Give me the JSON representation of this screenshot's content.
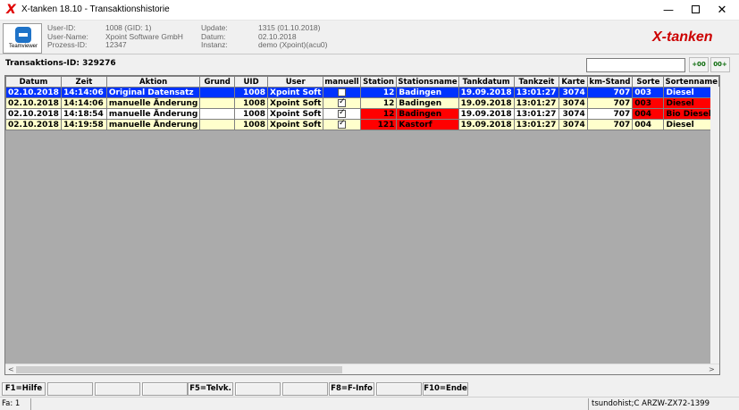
{
  "window": {
    "app_logo": "X",
    "title": "X-tanken 18.10  -  Transaktionshistorie",
    "min": "—",
    "max": "",
    "close": "✕"
  },
  "header": {
    "teamviewer": "Teamviewer",
    "labels": {
      "user_id": "User-ID:",
      "user_name": "User-Name:",
      "process_id": "Prozess-ID:",
      "update": "Update:",
      "datum": "Datum:",
      "instanz": "Instanz:"
    },
    "values": {
      "user_id": "1008 (GID: 1)",
      "user_name": "Xpoint Software GmbH",
      "process_id": "12347",
      "update": "1315 (01.10.2018)",
      "datum": "02.10.2018",
      "instanz": "demo (Xpoint)(acu0)"
    },
    "brand": "X-tanken"
  },
  "transaction_id": "Transaktions-ID: 329276",
  "toolbar": {
    "search_value": "",
    "btn1": "+00",
    "btn2": "00+"
  },
  "table": {
    "columns": [
      "Datum",
      "Zeit",
      "Aktion",
      "Grund",
      "UID",
      "User",
      "manuell",
      "Station",
      "Stationsname",
      "Tankdatum",
      "Tankzeit",
      "Karte",
      "km-Stand",
      "Sorte",
      "Sortenname"
    ],
    "rows": [
      [
        "02.10.2018",
        "14:14:06",
        "Original Datensatz",
        "",
        "1008",
        "Xpoint Soft",
        "",
        "12",
        "Badingen",
        "19.09.2018",
        "13:01:27",
        "3074",
        "707",
        "003",
        "Diesel"
      ],
      [
        "02.10.2018",
        "14:14:06",
        "manuelle Änderung",
        "",
        "1008",
        "Xpoint Soft",
        "",
        "12",
        "Badingen",
        "19.09.2018",
        "13:01:27",
        "3074",
        "707",
        "003",
        "Diesel"
      ],
      [
        "02.10.2018",
        "14:18:54",
        "manuelle Änderung",
        "",
        "1008",
        "Xpoint Soft",
        "",
        "12",
        "Badingen",
        "19.09.2018",
        "13:01:27",
        "3074",
        "707",
        "004",
        "Bio Diesel"
      ],
      [
        "02.10.2018",
        "14:19:58",
        "manuelle Änderung",
        "",
        "1008",
        "Xpoint Soft",
        "",
        "121",
        "Kastorf",
        "19.09.2018",
        "13:01:27",
        "3074",
        "707",
        "004",
        "Diesel"
      ]
    ]
  },
  "fkeys": [
    "F1=Hilfe",
    "",
    "",
    "",
    "F5=Telvk.",
    "",
    "",
    "F8=F-Info",
    "",
    "F10=Ende"
  ],
  "status": {
    "left": "Fa: 1",
    "right": "tsundohist;C ARZW-ZX72-1399"
  },
  "colors": {
    "selected_row": "#0033ff",
    "alt_row": "#ffffcc",
    "changed_cell": "#ff0000",
    "brand": "#cc0000"
  }
}
